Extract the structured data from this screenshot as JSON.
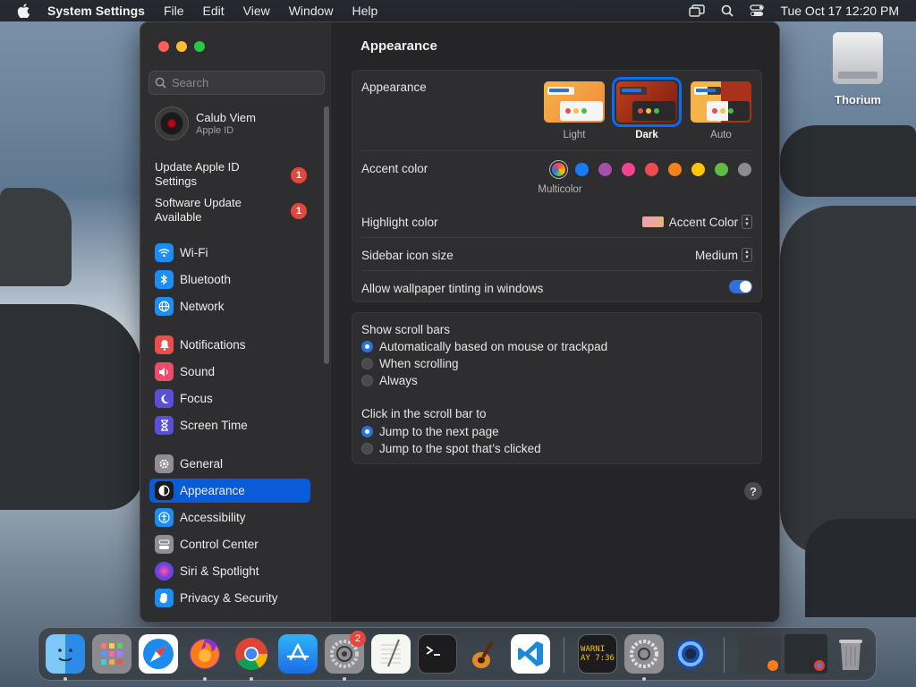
{
  "menubar": {
    "app_name": "System Settings",
    "menus": [
      "File",
      "Edit",
      "View",
      "Window",
      "Help"
    ],
    "clock": "Tue Oct 17  12:20 PM"
  },
  "desktop": {
    "drive_label": "Thorium"
  },
  "sidebar": {
    "search_placeholder": "Search",
    "profile": {
      "name": "Calub Viem",
      "subtitle": "Apple ID"
    },
    "notices": [
      {
        "label": "Update Apple ID Settings",
        "badge": "1"
      },
      {
        "label": "Software Update Available",
        "badge": "1"
      }
    ],
    "items": [
      {
        "label": "Wi-Fi",
        "icon": "wifi-icon",
        "color": "#1f8cf0"
      },
      {
        "label": "Bluetooth",
        "icon": "bluetooth-icon",
        "color": "#1f8cf0"
      },
      {
        "label": "Network",
        "icon": "globe-icon",
        "color": "#1f8cf0"
      },
      {
        "label": "Notifications",
        "icon": "bell-icon",
        "color": "#ee4b4b"
      },
      {
        "label": "Sound",
        "icon": "speaker-icon",
        "color": "#ee4b6a"
      },
      {
        "label": "Focus",
        "icon": "moon-icon",
        "color": "#5a50d8"
      },
      {
        "label": "Screen Time",
        "icon": "hourglass-icon",
        "color": "#5a50d8"
      },
      {
        "label": "General",
        "icon": "gear-icon",
        "color": "#8e8e93"
      },
      {
        "label": "Appearance",
        "icon": "appearance-icon",
        "color": "#1c1c1e"
      },
      {
        "label": "Accessibility",
        "icon": "accessibility-icon",
        "color": "#1f8cf0"
      },
      {
        "label": "Control Center",
        "icon": "control-center-icon",
        "color": "#8e8e93"
      },
      {
        "label": "Siri & Spotlight",
        "icon": "siri-icon",
        "color": "#9b3de0"
      },
      {
        "label": "Privacy & Security",
        "icon": "hand-icon",
        "color": "#1f8cf0"
      }
    ],
    "selected": "Appearance"
  },
  "content": {
    "title": "Appearance",
    "appearance": {
      "label": "Appearance",
      "options": [
        "Light",
        "Dark",
        "Auto"
      ],
      "selected": "Dark"
    },
    "accent": {
      "label": "Accent color",
      "selected_label": "Multicolor",
      "colors": [
        "#8e8e93",
        "#1a7cf5",
        "#a550a7",
        "#f7438d",
        "#ee4c52",
        "#f7821b",
        "#ffc600",
        "#62ba46",
        "#8c8c8c"
      ]
    },
    "highlight": {
      "label": "Highlight color",
      "value": "Accent Color"
    },
    "icon_size": {
      "label": "Sidebar icon size",
      "value": "Medium"
    },
    "tinting": {
      "label": "Allow wallpaper tinting in windows",
      "on": true
    },
    "scroll_bars": {
      "label": "Show scroll bars",
      "options": [
        "Automatically based on mouse or trackpad",
        "When scrolling",
        "Always"
      ],
      "selected": 0
    },
    "click_scroll": {
      "label": "Click in the scroll bar to",
      "options": [
        "Jump to the next page",
        "Jump to the spot that’s clicked"
      ],
      "selected": 0
    },
    "help": "?"
  },
  "dock": {
    "settings_badge": "2",
    "console_text": "WARNI\nAY 7:36"
  }
}
